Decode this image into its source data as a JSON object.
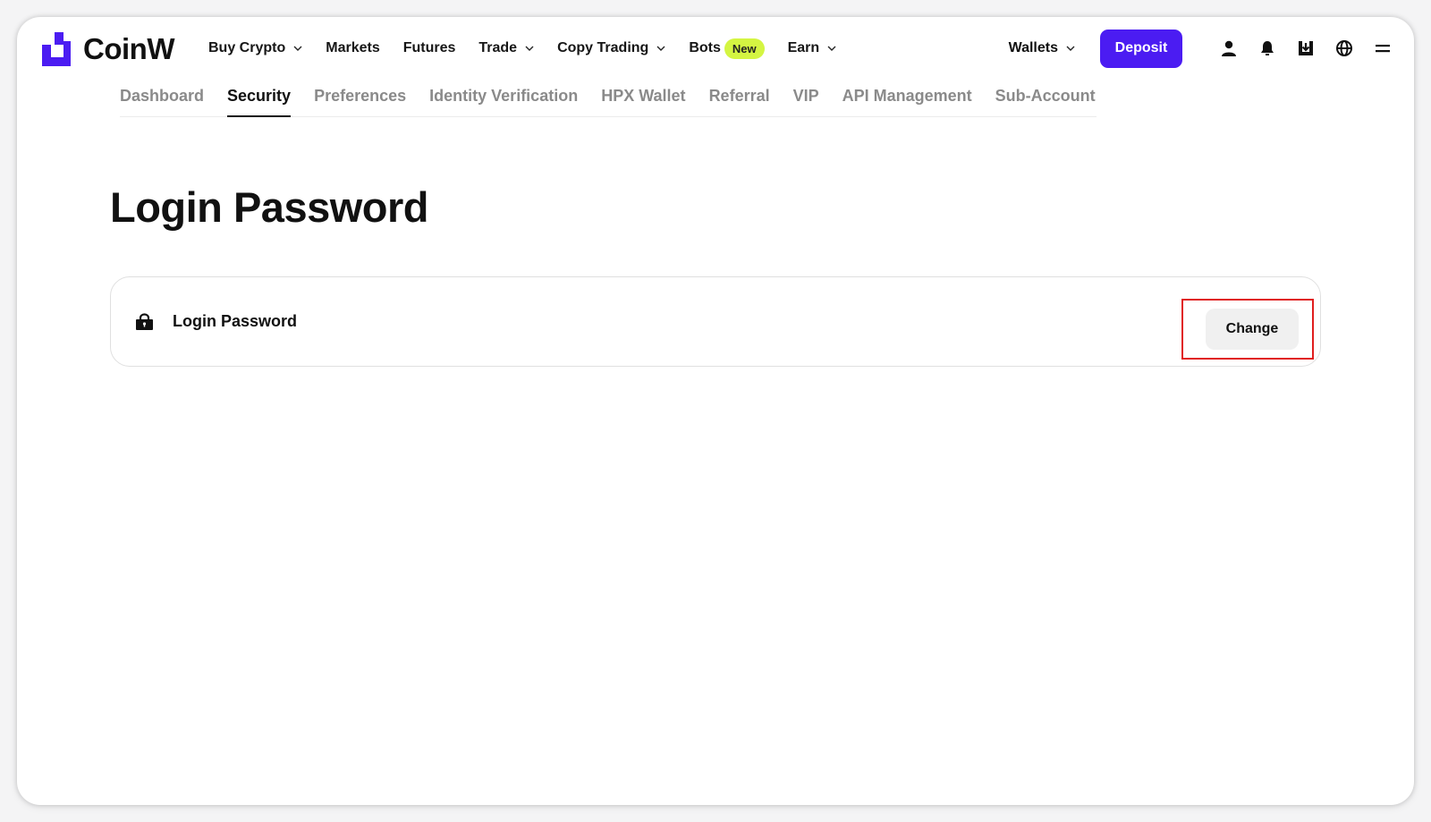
{
  "brand": {
    "name": "CoinW",
    "accent_color": "#4b1cf2"
  },
  "topnav": {
    "items": [
      {
        "label": "Buy Crypto",
        "has_dropdown": true
      },
      {
        "label": "Markets",
        "has_dropdown": false
      },
      {
        "label": "Futures",
        "has_dropdown": false
      },
      {
        "label": "Trade",
        "has_dropdown": true
      },
      {
        "label": "Copy Trading",
        "has_dropdown": true
      },
      {
        "label": "Bots",
        "badge": "New",
        "has_dropdown": false
      },
      {
        "label": "Earn",
        "has_dropdown": true
      }
    ],
    "wallets_label": "Wallets",
    "deposit_label": "Deposit",
    "icons": [
      "user-icon",
      "bell-icon",
      "download-icon",
      "globe-icon",
      "menu-icon"
    ]
  },
  "subtabs": {
    "items": [
      {
        "label": "Dashboard",
        "active": false
      },
      {
        "label": "Security",
        "active": true
      },
      {
        "label": "Preferences",
        "active": false
      },
      {
        "label": "Identity Verification",
        "active": false
      },
      {
        "label": "HPX Wallet",
        "active": false
      },
      {
        "label": "Referral",
        "active": false
      },
      {
        "label": "VIP",
        "active": false
      },
      {
        "label": "API Management",
        "active": false
      },
      {
        "label": "Sub-Account",
        "active": false
      }
    ]
  },
  "main": {
    "title": "Login Password",
    "card": {
      "icon": "lock-icon",
      "label": "Login Password",
      "action_label": "Change"
    },
    "highlight_color": "#e01e1e"
  }
}
